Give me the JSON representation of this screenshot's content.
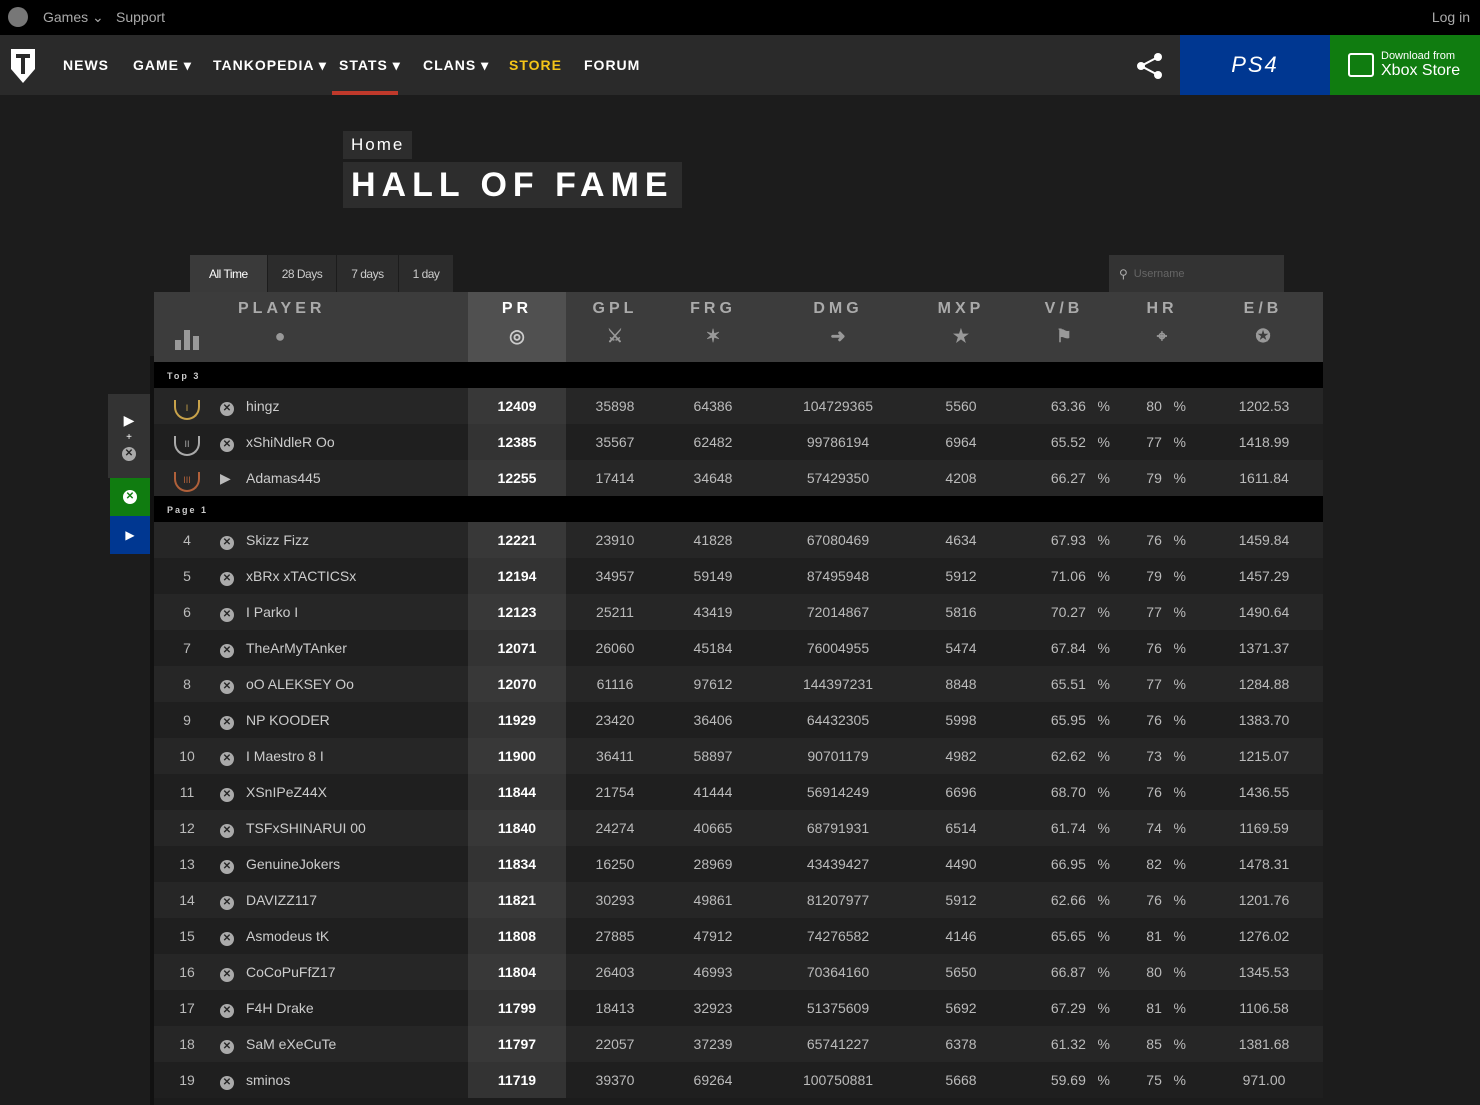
{
  "topbar": {
    "games": "Games ⌄",
    "support": "Support",
    "login": "Log in"
  },
  "nav": {
    "items": [
      "NEWS",
      "GAME ▾",
      "TANKOPEDIA ▾",
      "STATS ▾",
      "CLANS ▾",
      "STORE",
      "FORUM"
    ],
    "ps4_label": "PS4",
    "xbox_small": "Download from",
    "xbox_big": "Xbox Store"
  },
  "breadcrumb": "Home",
  "page_title": "HALL OF FAME",
  "tabs": [
    "All Time",
    "28 Days",
    "7 days",
    "1 day"
  ],
  "search": {
    "placeholder": "Username"
  },
  "table": {
    "headers": {
      "player": "PLAYER",
      "pr": "PR",
      "gpl": "GPL",
      "frg": "FRG",
      "dmg": "DMG",
      "mxp": "MXP",
      "vb": "V/B",
      "hr": "HR",
      "eb": "E/B"
    },
    "section_top": "Top 3",
    "section_page": "Page 1",
    "top3": [
      {
        "name": "hingz",
        "platform": "xbox",
        "pr": "12409",
        "gpl": "35898",
        "frg": "64386",
        "dmg": "104729365",
        "mxp": "5560",
        "vb": "63.36",
        "hr": "80",
        "eb": "1202.53"
      },
      {
        "name": "xShiNdleR Oo",
        "platform": "xbox",
        "pr": "12385",
        "gpl": "35567",
        "frg": "62482",
        "dmg": "99786194",
        "mxp": "6964",
        "vb": "65.52",
        "hr": "77",
        "eb": "1418.99"
      },
      {
        "name": "Adamas445",
        "platform": "ps",
        "pr": "12255",
        "gpl": "17414",
        "frg": "34648",
        "dmg": "57429350",
        "mxp": "4208",
        "vb": "66.27",
        "hr": "79",
        "eb": "1611.84"
      }
    ],
    "rows": [
      {
        "rank": "4",
        "name": "Skizz Fizz",
        "pr": "12221",
        "gpl": "23910",
        "frg": "41828",
        "dmg": "67080469",
        "mxp": "4634",
        "vb": "67.93",
        "hr": "76",
        "eb": "1459.84"
      },
      {
        "rank": "5",
        "name": "xBRx xTACTICSx",
        "pr": "12194",
        "gpl": "34957",
        "frg": "59149",
        "dmg": "87495948",
        "mxp": "5912",
        "vb": "71.06",
        "hr": "79",
        "eb": "1457.29"
      },
      {
        "rank": "6",
        "name": "I Parko I",
        "pr": "12123",
        "gpl": "25211",
        "frg": "43419",
        "dmg": "72014867",
        "mxp": "5816",
        "vb": "70.27",
        "hr": "77",
        "eb": "1490.64"
      },
      {
        "rank": "7",
        "name": "TheArMyTAnker",
        "pr": "12071",
        "gpl": "26060",
        "frg": "45184",
        "dmg": "76004955",
        "mxp": "5474",
        "vb": "67.84",
        "hr": "76",
        "eb": "1371.37"
      },
      {
        "rank": "8",
        "name": "oO ALEKSEY Oo",
        "pr": "12070",
        "gpl": "61116",
        "frg": "97612",
        "dmg": "144397231",
        "mxp": "8848",
        "vb": "65.51",
        "hr": "77",
        "eb": "1284.88"
      },
      {
        "rank": "9",
        "name": "NP KOODER",
        "pr": "11929",
        "gpl": "23420",
        "frg": "36406",
        "dmg": "64432305",
        "mxp": "5998",
        "vb": "65.95",
        "hr": "76",
        "eb": "1383.70"
      },
      {
        "rank": "10",
        "name": "I Maestro 8 I",
        "pr": "11900",
        "gpl": "36411",
        "frg": "58897",
        "dmg": "90701179",
        "mxp": "4982",
        "vb": "62.62",
        "hr": "73",
        "eb": "1215.07"
      },
      {
        "rank": "11",
        "name": "XSnIPeZ44X",
        "pr": "11844",
        "gpl": "21754",
        "frg": "41444",
        "dmg": "56914249",
        "mxp": "6696",
        "vb": "68.70",
        "hr": "76",
        "eb": "1436.55"
      },
      {
        "rank": "12",
        "name": "TSFxSHINARUI 00",
        "pr": "11840",
        "gpl": "24274",
        "frg": "40665",
        "dmg": "68791931",
        "mxp": "6514",
        "vb": "61.74",
        "hr": "74",
        "eb": "1169.59"
      },
      {
        "rank": "13",
        "name": "GenuineJokers",
        "pr": "11834",
        "gpl": "16250",
        "frg": "28969",
        "dmg": "43439427",
        "mxp": "4490",
        "vb": "66.95",
        "hr": "82",
        "eb": "1478.31"
      },
      {
        "rank": "14",
        "name": "DAVIZZ117",
        "pr": "11821",
        "gpl": "30293",
        "frg": "49861",
        "dmg": "81207977",
        "mxp": "5912",
        "vb": "62.66",
        "hr": "76",
        "eb": "1201.76"
      },
      {
        "rank": "15",
        "name": "Asmodeus tK",
        "pr": "11808",
        "gpl": "27885",
        "frg": "47912",
        "dmg": "74276582",
        "mxp": "4146",
        "vb": "65.65",
        "hr": "81",
        "eb": "1276.02"
      },
      {
        "rank": "16",
        "name": "CoCoPuFfZ17",
        "pr": "11804",
        "gpl": "26403",
        "frg": "46993",
        "dmg": "70364160",
        "mxp": "5650",
        "vb": "66.87",
        "hr": "80",
        "eb": "1345.53"
      },
      {
        "rank": "17",
        "name": "F4H Drake",
        "pr": "11799",
        "gpl": "18413",
        "frg": "32923",
        "dmg": "51375609",
        "mxp": "5692",
        "vb": "67.29",
        "hr": "81",
        "eb": "1106.58"
      },
      {
        "rank": "18",
        "name": "SaM eXeCuTe",
        "pr": "11797",
        "gpl": "22057",
        "frg": "37239",
        "dmg": "65741227",
        "mxp": "6378",
        "vb": "61.32",
        "hr": "85",
        "eb": "1381.68"
      },
      {
        "rank": "19",
        "name": "sminos",
        "pr": "11719",
        "gpl": "39370",
        "frg": "69264",
        "dmg": "100750881",
        "mxp": "5668",
        "vb": "59.69",
        "hr": "75",
        "eb": "971.00"
      }
    ]
  },
  "colors": {
    "accent_red": "#c0392b",
    "store_yellow": "#f5c518",
    "ps_blue": "#003791",
    "xbox_green": "#107c10"
  }
}
